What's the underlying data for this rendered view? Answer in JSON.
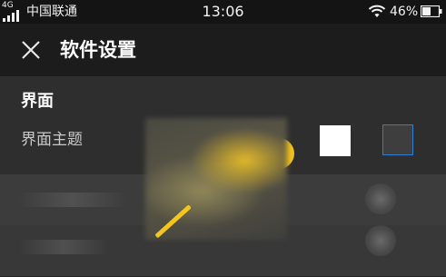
{
  "status_bar": {
    "network": "4G",
    "carrier": "中国联通",
    "time": "13:06",
    "battery_percent": "46%",
    "icons": [
      "signal-icon",
      "wifi-icon",
      "battery-icon"
    ]
  },
  "header": {
    "title": "软件设置",
    "close_icon": "close-icon"
  },
  "interface_section": {
    "heading": "界面",
    "theme_label": "界面主题",
    "theme_options": [
      {
        "name": "yellow",
        "color": "#f3c21a"
      },
      {
        "name": "white",
        "color": "#ffffff"
      },
      {
        "name": "dark",
        "color": "#3e3e3e",
        "selected": true
      }
    ]
  },
  "colors": {
    "status_bar_bg": "#141414",
    "title_bar_bg": "#1c1c1c",
    "section_bg": "#2e2e2e",
    "accent_yellow": "#f3c21a",
    "selection_border": "#2f7fd1"
  }
}
